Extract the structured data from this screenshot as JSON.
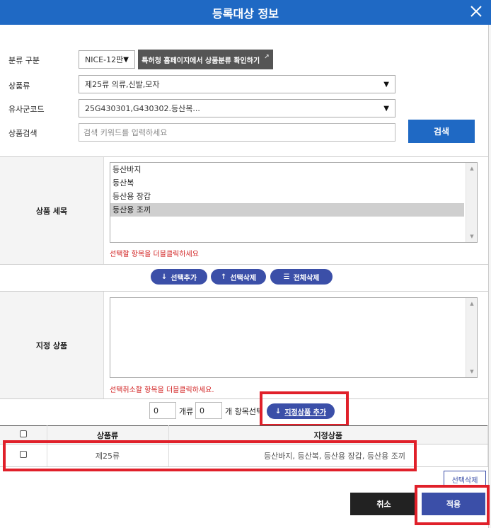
{
  "dialog": {
    "title": "등록대상 정보"
  },
  "form": {
    "classification_label": "분류 구분",
    "classification_value": "NICE-12판",
    "kipris_button": "특허청 홈페이지에서 상품분류 확인하기",
    "product_class_label": "상품류",
    "product_class_value": "제25류 의류,신발,모자",
    "similar_code_label": "유사군코드",
    "similar_code_value": "25G430301,G430302.등산복...",
    "search_label": "상품검색",
    "search_placeholder": "검색 키워드를 입력하세요",
    "search_button": "검색"
  },
  "detail": {
    "label": "상품 세목",
    "items": [
      "등산바지",
      "등산복",
      "등산용 장갑",
      "등산용 조끼"
    ],
    "selected_index": 3,
    "hint": "선택할 항목을 더블클릭하세요"
  },
  "actions": {
    "add_selected": "선택추가",
    "delete_selected": "선택삭제",
    "delete_all": "전체삭제"
  },
  "designated": {
    "label": "지정 상품",
    "items": [],
    "hint": "선택취소할 항목을 더블클릭하세요."
  },
  "counter": {
    "class_count": "0",
    "class_suffix": "개류",
    "item_count": "0",
    "item_suffix": "개 항목선택",
    "add_designated": "지정상품 추가"
  },
  "table": {
    "headers": [
      "상품류",
      "지정상품"
    ],
    "rows": [
      {
        "class": "제25류",
        "products": "등산바지, 등산복, 등산용 장갑, 등산용 조끼"
      }
    ],
    "delete_selected": "선택삭제"
  },
  "footer": {
    "cancel": "취소",
    "apply": "적용"
  },
  "colors": {
    "header_blue": "#1f69c4",
    "pill_blue": "#3b4fa8",
    "highlight_red": "#e0202a"
  }
}
